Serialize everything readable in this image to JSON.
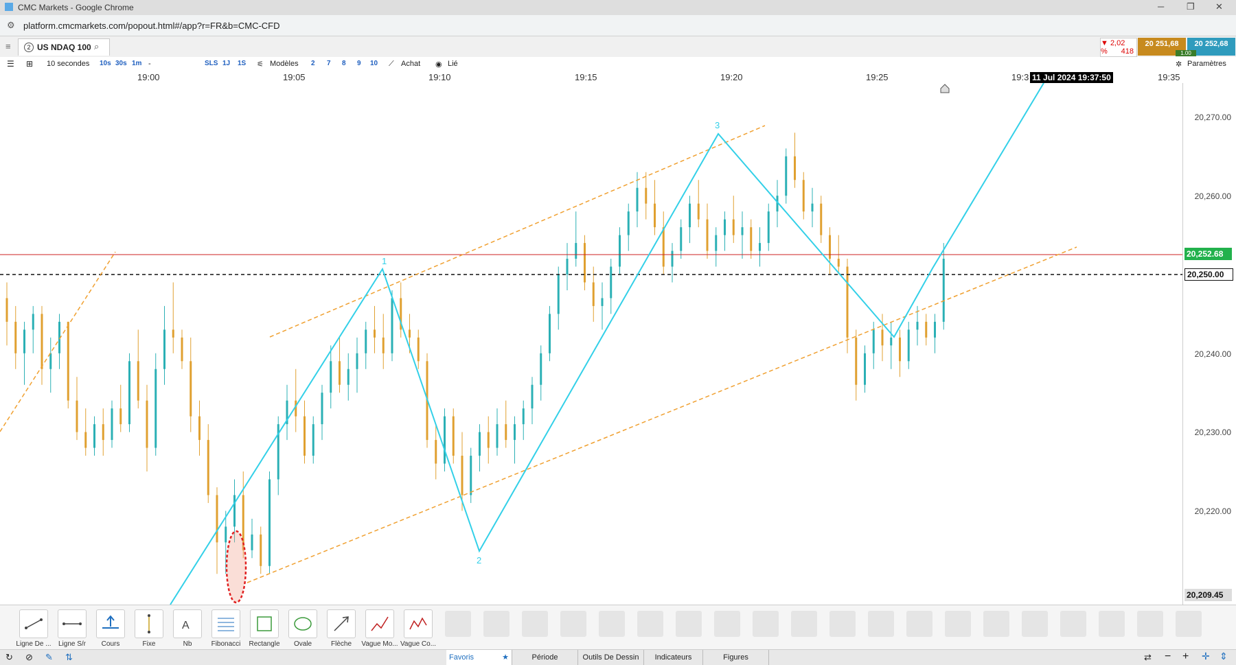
{
  "window": {
    "title": "CMC Markets - Google Chrome"
  },
  "browser": {
    "url": "platform.cmcmarkets.com/popout.html#/app?r=FR&b=CMC-CFD"
  },
  "instrument": {
    "tab_number": "2",
    "name": "US NDAQ 100"
  },
  "quote": {
    "change_pct": "▼ 2,02 %",
    "change_pts": "418",
    "sell": "20 251,68",
    "buy": "20 252,68",
    "spread": "1.00"
  },
  "toolbar": {
    "interval": "10 secondes",
    "intervals": [
      "10s",
      "30s",
      "1m"
    ],
    "dash": "-",
    "sls": "SLS",
    "onej": "1J",
    "ones": "1S",
    "models": "Modèles",
    "nums": [
      "2",
      "7",
      "8",
      "9",
      "10"
    ],
    "achat": "Achat",
    "lie": "Lié",
    "params": "Paramètres"
  },
  "time_axis": {
    "labels": [
      "19:00",
      "19:05",
      "19:10",
      "19:15",
      "19:20",
      "19:25",
      "19:3",
      "19:35"
    ],
    "cursor_time": "11 Jul 2024 19:37:50"
  },
  "price_axis": {
    "labels": [
      "20,270.00",
      "20,260.00",
      "20,240.00",
      "20,230.00",
      "20,220.00"
    ],
    "current": "20,252.68",
    "line": "20,250.00",
    "low": "20,209.45"
  },
  "wave_labels": [
    "1",
    "2",
    "3"
  ],
  "chart_data": {
    "type": "candlestick",
    "instrument": "US NDAQ 100",
    "interval": "10 secondes",
    "y_ticks": [
      20270,
      20260,
      20240,
      20230,
      20220
    ],
    "current_price": 20252.68,
    "horizontal_line": 20250.0,
    "visible_low": 20209.45,
    "candles": [
      [
        20247,
        20249,
        20241,
        20244
      ],
      [
        20244,
        20246,
        20238,
        20240
      ],
      [
        20240,
        20244,
        20236,
        20243
      ],
      [
        20243,
        20246,
        20240,
        20245
      ],
      [
        20245,
        20246,
        20236,
        20238
      ],
      [
        20238,
        20242,
        20235,
        20240
      ],
      [
        20240,
        20245,
        20238,
        20244
      ],
      [
        20244,
        20244,
        20233,
        20234
      ],
      [
        20234,
        20237,
        20229,
        20230
      ],
      [
        20230,
        20233,
        20227,
        20228
      ],
      [
        20228,
        20232,
        20227,
        20231
      ],
      [
        20231,
        20233,
        20227,
        20229
      ],
      [
        20229,
        20234,
        20228,
        20233
      ],
      [
        20233,
        20236,
        20230,
        20231
      ],
      [
        20231,
        20240,
        20230,
        20239
      ],
      [
        20239,
        20243,
        20233,
        20234
      ],
      [
        20234,
        20236,
        20225,
        20228
      ],
      [
        20228,
        20240,
        20227,
        20238
      ],
      [
        20238,
        20246,
        20236,
        20243
      ],
      [
        20243,
        20249,
        20240,
        20242
      ],
      [
        20242,
        20243,
        20238,
        20239
      ],
      [
        20239,
        20242,
        20230,
        20232
      ],
      [
        20232,
        20234,
        20227,
        20229
      ],
      [
        20229,
        20231,
        20221,
        20222
      ],
      [
        20222,
        20223,
        20212,
        20216
      ],
      [
        20216,
        20220,
        20212,
        20218
      ],
      [
        20218,
        20224,
        20216,
        20222
      ],
      [
        20222,
        20225,
        20214,
        20215
      ],
      [
        20215,
        20219,
        20214,
        20217
      ],
      [
        20217,
        20218,
        20212,
        20213
      ],
      [
        20213,
        20225,
        20212,
        20224
      ],
      [
        20224,
        20232,
        20222,
        20231
      ],
      [
        20231,
        20236,
        20229,
        20234
      ],
      [
        20234,
        20238,
        20230,
        20232
      ],
      [
        20232,
        20234,
        20226,
        20227
      ],
      [
        20227,
        20232,
        20226,
        20231
      ],
      [
        20231,
        20236,
        20229,
        20235
      ],
      [
        20235,
        20241,
        20233,
        20239
      ],
      [
        20239,
        20242,
        20235,
        20236
      ],
      [
        20236,
        20240,
        20234,
        20238
      ],
      [
        20238,
        20242,
        20235,
        20240
      ],
      [
        20240,
        20244,
        20238,
        20243
      ],
      [
        20243,
        20246,
        20240,
        20242
      ],
      [
        20242,
        20245,
        20238,
        20240
      ],
      [
        20240,
        20248,
        20239,
        20247
      ],
      [
        20247,
        20249,
        20242,
        20243
      ],
      [
        20243,
        20245,
        20240,
        20242
      ],
      [
        20242,
        20243,
        20238,
        20239
      ],
      [
        20239,
        20240,
        20228,
        20229
      ],
      [
        20229,
        20231,
        20224,
        20226
      ],
      [
        20226,
        20233,
        20225,
        20232
      ],
      [
        20232,
        20233,
        20226,
        20227
      ],
      [
        20227,
        20230,
        20220,
        20222
      ],
      [
        20222,
        20228,
        20221,
        20227
      ],
      [
        20227,
        20231,
        20225,
        20230
      ],
      [
        20230,
        20232,
        20226,
        20228
      ],
      [
        20228,
        20233,
        20227,
        20231
      ],
      [
        20231,
        20234,
        20228,
        20229
      ],
      [
        20229,
        20232,
        20226,
        20231
      ],
      [
        20231,
        20234,
        20229,
        20233
      ],
      [
        20233,
        20237,
        20231,
        20236
      ],
      [
        20236,
        20241,
        20234,
        20240
      ],
      [
        20240,
        20246,
        20239,
        20245
      ],
      [
        20245,
        20251,
        20243,
        20250
      ],
      [
        20250,
        20254,
        20248,
        20252
      ],
      [
        20252,
        20258,
        20251,
        20254
      ],
      [
        20254,
        20255,
        20248,
        20249
      ],
      [
        20249,
        20251,
        20244,
        20246
      ],
      [
        20246,
        20249,
        20243,
        20247
      ],
      [
        20247,
        20252,
        20245,
        20251
      ],
      [
        20251,
        20256,
        20250,
        20255
      ],
      [
        20255,
        20259,
        20253,
        20258
      ],
      [
        20258,
        20263,
        20256,
        20261
      ],
      [
        20261,
        20263,
        20257,
        20259
      ],
      [
        20259,
        20262,
        20255,
        20256
      ],
      [
        20256,
        20258,
        20250,
        20251
      ],
      [
        20251,
        20254,
        20249,
        20253
      ],
      [
        20253,
        20257,
        20252,
        20256
      ],
      [
        20256,
        20260,
        20254,
        20259
      ],
      [
        20259,
        20262,
        20256,
        20257
      ],
      [
        20257,
        20259,
        20252,
        20253
      ],
      [
        20253,
        20256,
        20251,
        20255
      ],
      [
        20255,
        20258,
        20253,
        20257
      ],
      [
        20257,
        20260,
        20254,
        20255
      ],
      [
        20255,
        20258,
        20252,
        20256
      ],
      [
        20256,
        20257,
        20252,
        20253
      ],
      [
        20253,
        20256,
        20251,
        20254
      ],
      [
        20254,
        20259,
        20253,
        20258
      ],
      [
        20258,
        20262,
        20256,
        20260
      ],
      [
        20260,
        20266,
        20259,
        20265
      ],
      [
        20265,
        20268,
        20261,
        20262
      ],
      [
        20262,
        20263,
        20257,
        20258
      ],
      [
        20258,
        20261,
        20256,
        20259
      ],
      [
        20259,
        20260,
        20254,
        20255
      ],
      [
        20255,
        20256,
        20250,
        20252
      ],
      [
        20252,
        20255,
        20250,
        20251
      ],
      [
        20251,
        20252,
        20240,
        20242
      ],
      [
        20242,
        20243,
        20234,
        20236
      ],
      [
        20236,
        20241,
        20235,
        20240
      ],
      [
        20240,
        20244,
        20238,
        20243
      ],
      [
        20243,
        20245,
        20239,
        20241
      ],
      [
        20241,
        20244,
        20238,
        20242
      ],
      [
        20242,
        20243,
        20237,
        20239
      ],
      [
        20239,
        20244,
        20238,
        20243
      ],
      [
        20243,
        20246,
        20241,
        20244
      ],
      [
        20244,
        20245,
        20241,
        20242
      ],
      [
        20242,
        20245,
        20240,
        20244
      ],
      [
        20244,
        20254,
        20243,
        20252
      ]
    ]
  },
  "tools": [
    {
      "label": "Ligne De ...",
      "icon": "trend-line-icon"
    },
    {
      "label": "Ligne S/r",
      "icon": "horizontal-line-icon"
    },
    {
      "label": "Cours",
      "icon": "price-icon"
    },
    {
      "label": "Fixe",
      "icon": "vertical-line-icon"
    },
    {
      "label": "Nb",
      "icon": "text-icon"
    },
    {
      "label": "Fibonacci",
      "icon": "fibonacci-icon"
    },
    {
      "label": "Rectangle",
      "icon": "rectangle-icon"
    },
    {
      "label": "Ovale",
      "icon": "oval-icon"
    },
    {
      "label": "Flèche",
      "icon": "arrow-icon"
    },
    {
      "label": "Vague Mo...",
      "icon": "wave-icon"
    },
    {
      "label": "Vague Co...",
      "icon": "corrective-wave-icon"
    }
  ],
  "bottom_tabs": [
    "Favoris",
    "Période",
    "Outils De Dessin",
    "Indicateurs",
    "Figures"
  ],
  "colors": {
    "up": "#2bb0b5",
    "down": "#e0a030",
    "wave": "#33d0e8",
    "channel": "#f0a030",
    "accent_green": "#22b14c"
  }
}
